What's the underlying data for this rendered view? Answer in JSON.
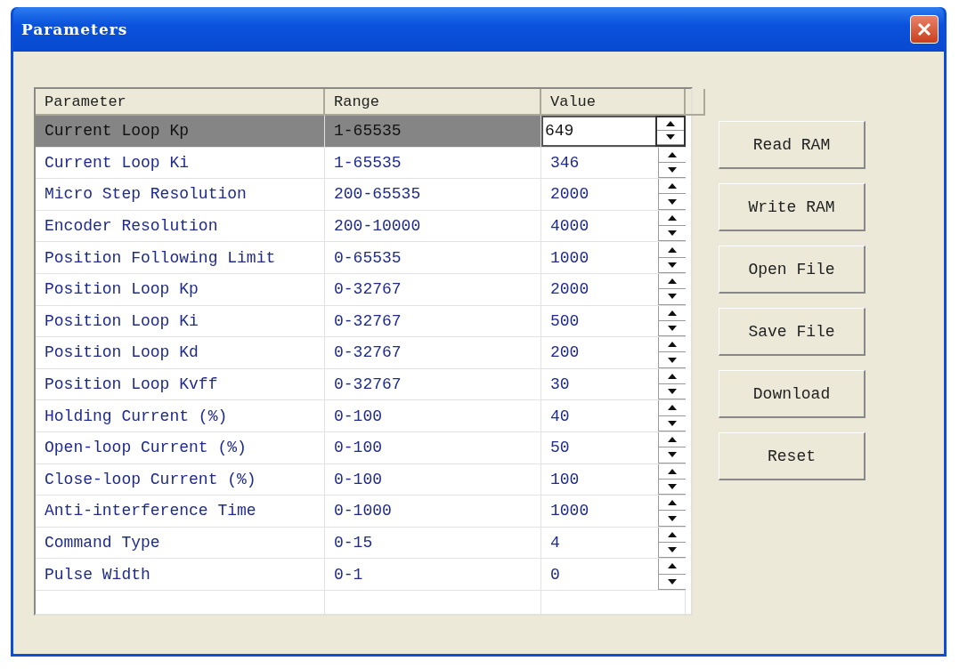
{
  "window": {
    "title": "Parameters"
  },
  "table": {
    "columns": [
      "Parameter",
      "Range",
      "Value"
    ],
    "rows": [
      {
        "parameter": "Current Loop Kp",
        "range": "1-65535",
        "value": "649",
        "selected": true
      },
      {
        "parameter": "Current Loop Ki",
        "range": "1-65535",
        "value": "346",
        "selected": false
      },
      {
        "parameter": "Micro Step Resolution",
        "range": "200-65535",
        "value": "2000",
        "selected": false
      },
      {
        "parameter": "Encoder Resolution",
        "range": "200-10000",
        "value": "4000",
        "selected": false
      },
      {
        "parameter": "Position Following Limit",
        "range": "0-65535",
        "value": "1000",
        "selected": false
      },
      {
        "parameter": "Position Loop Kp",
        "range": "0-32767",
        "value": "2000",
        "selected": false
      },
      {
        "parameter": "Position Loop Ki",
        "range": "0-32767",
        "value": "500",
        "selected": false
      },
      {
        "parameter": "Position Loop Kd",
        "range": "0-32767",
        "value": "200",
        "selected": false
      },
      {
        "parameter": "Position Loop Kvff",
        "range": "0-32767",
        "value": "30",
        "selected": false
      },
      {
        "parameter": "Holding Current (%)",
        "range": "0-100",
        "value": "40",
        "selected": false
      },
      {
        "parameter": "Open-loop Current (%)",
        "range": "0-100",
        "value": "50",
        "selected": false
      },
      {
        "parameter": "Close-loop Current (%)",
        "range": "0-100",
        "value": "100",
        "selected": false
      },
      {
        "parameter": "Anti-interference Time",
        "range": "0-1000",
        "value": "1000",
        "selected": false
      },
      {
        "parameter": "Command Type",
        "range": "0-15",
        "value": "4",
        "selected": false
      },
      {
        "parameter": "Pulse Width",
        "range": "0-1",
        "value": "0",
        "selected": false
      }
    ]
  },
  "buttons": [
    "Read RAM",
    "Write RAM",
    "Open File",
    "Save File",
    "Download",
    "Reset"
  ]
}
